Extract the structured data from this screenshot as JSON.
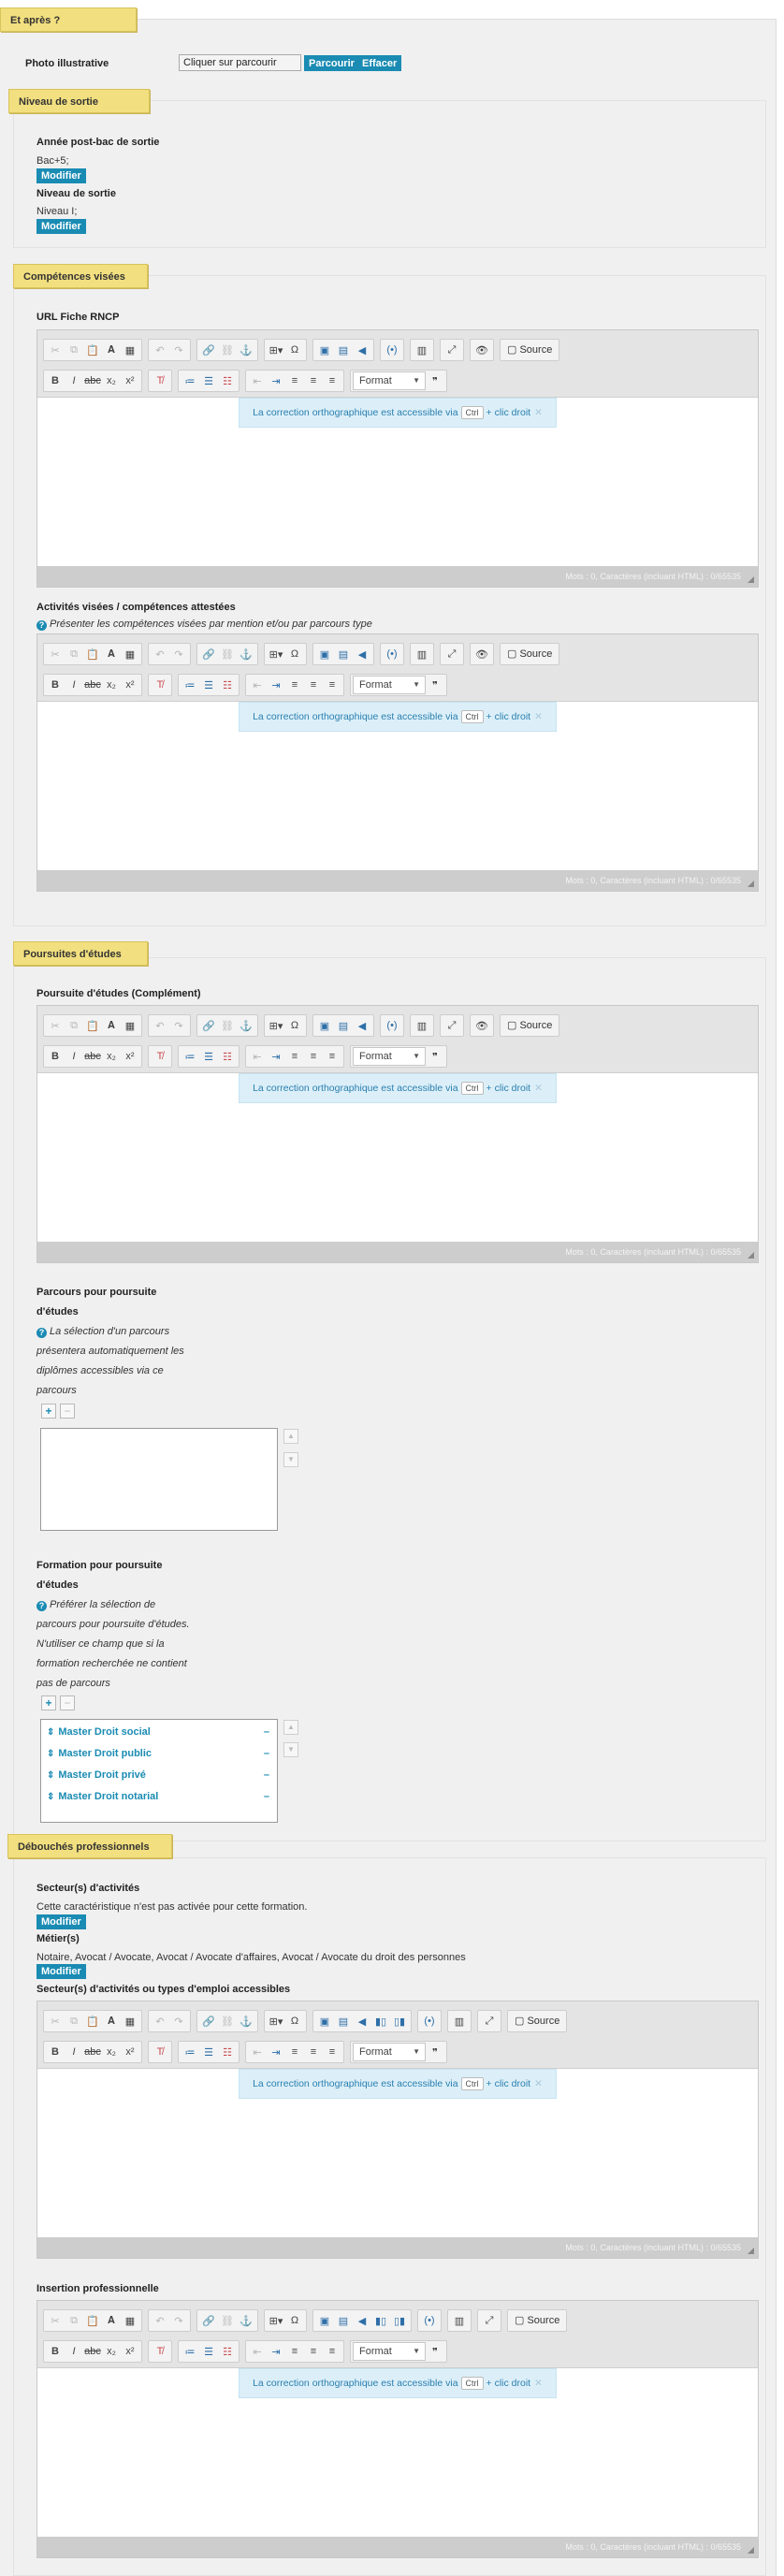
{
  "section_apres": {
    "title": "Et après ?"
  },
  "photo": {
    "label": "Photo illustrative",
    "input_value": "Cliquer sur parcourir",
    "browse_label": "Parcourir",
    "clear_label": "Effacer"
  },
  "niveau": {
    "title": "Niveau de sortie",
    "annee_label": "Année post-bac de sortie",
    "annee_value": "Bac+5;",
    "modifier_label": "Modifier",
    "niveau_label": "Niveau de sortie",
    "niveau_value": "Niveau I;"
  },
  "competences": {
    "title": "Compétences visées",
    "url_label": "URL Fiche RNCP",
    "activites_label": "Activités visées / compétences attestées",
    "activites_hint": "Présenter les compétences visées par mention et/ou par parcours type"
  },
  "editor": {
    "source_label": "Source",
    "format_label": "Format",
    "spell_text": "La correction orthographique est accessible via",
    "spell_key": "Ctrl",
    "spell_suffix": "+ clic droit",
    "status": "Mots : 0, Caractères (incluant HTML) : 0/65535"
  },
  "poursuites": {
    "title": "Poursuites d'études",
    "complement_label": "Poursuite d'études (Complément)",
    "parcours_label_1": "Parcours pour poursuite",
    "parcours_label_2": "d'études",
    "parcours_hint_1": "La sélection d'un parcours",
    "parcours_hint_2": "présentera automatiquement les",
    "parcours_hint_3": "diplômes accessibles via ce",
    "parcours_hint_4": "parcours",
    "formation_label_1": "Formation pour poursuite",
    "formation_label_2": "d'études",
    "formation_hint_1": "Préférer la sélection de",
    "formation_hint_2": "parcours pour poursuite d'études.",
    "formation_hint_3": "N'utiliser ce champ que si la",
    "formation_hint_4": "formation recherchée ne contient",
    "formation_hint_5": "pas de parcours",
    "formations": [
      "Master Droit social",
      "Master Droit public",
      "Master Droit privé",
      "Master Droit notarial"
    ]
  },
  "debouches": {
    "title": "Débouchés professionnels",
    "secteurs_label": "Secteur(s) d'activités",
    "secteurs_note": "Cette caractéristique n'est pas activée pour cette formation.",
    "metiers_label": "Métier(s)",
    "metiers_value": "Notaire, Avocat / Avocate, Avocat / Avocate d'affaires, Avocat / Avocate du droit des personnes",
    "secteurs_emploi_label": "Secteur(s) d'activités ou types d'emploi accessibles",
    "insertion_label": "Insertion professionnelle"
  }
}
